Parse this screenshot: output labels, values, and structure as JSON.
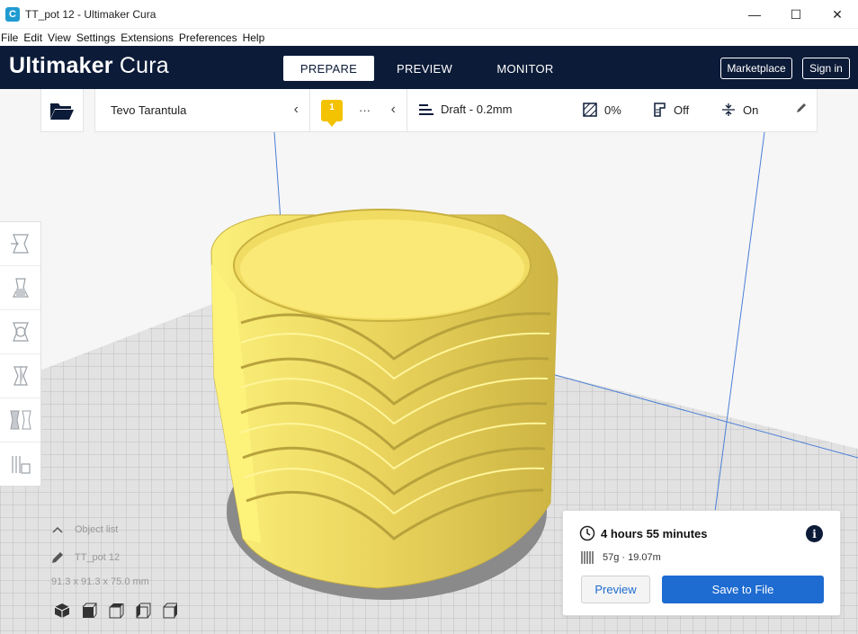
{
  "window": {
    "title": "TT_pot 12 - Ultimaker Cura",
    "app_icon_letter": "C",
    "controls": {
      "minimize": "—",
      "maximize": "☐",
      "close": "✕"
    }
  },
  "menubar": {
    "items": [
      {
        "label": "File"
      },
      {
        "label": "Edit"
      },
      {
        "label": "View"
      },
      {
        "label": "Settings"
      },
      {
        "label": "Extensions"
      },
      {
        "label": "Preferences"
      },
      {
        "label": "Help"
      }
    ]
  },
  "header": {
    "brand_bold": "Ultimaker",
    "brand_regular": "Cura",
    "tabs": [
      {
        "label": "PREPARE",
        "active": true
      },
      {
        "label": "PREVIEW",
        "active": false
      },
      {
        "label": "MONITOR",
        "active": false
      }
    ],
    "marketplace_label": "Marketplace",
    "signin_label": "Sign in"
  },
  "toolbar": {
    "printer_name": "Tevo Tarantula",
    "extruder_number": "1",
    "material_label": "···",
    "profile_label": "Draft - 0.2mm",
    "infill_label": "0%",
    "support_label": "Off",
    "adhesion_label": "On"
  },
  "object_list": {
    "toggle_label": "Object list",
    "object_name": "TT_pot 12",
    "dimensions": "91.3 x 91.3 x 75.0 mm"
  },
  "print_info": {
    "time": "4 hours 55 minutes",
    "material": "57g · 19.07m",
    "preview_label": "Preview",
    "save_label": "Save to File"
  },
  "colors": {
    "header_bg": "#0c1b38",
    "accent_blue": "#1e6bd1",
    "model_yellow": "#f6e36a",
    "extruder_badge": "#f3c200"
  }
}
